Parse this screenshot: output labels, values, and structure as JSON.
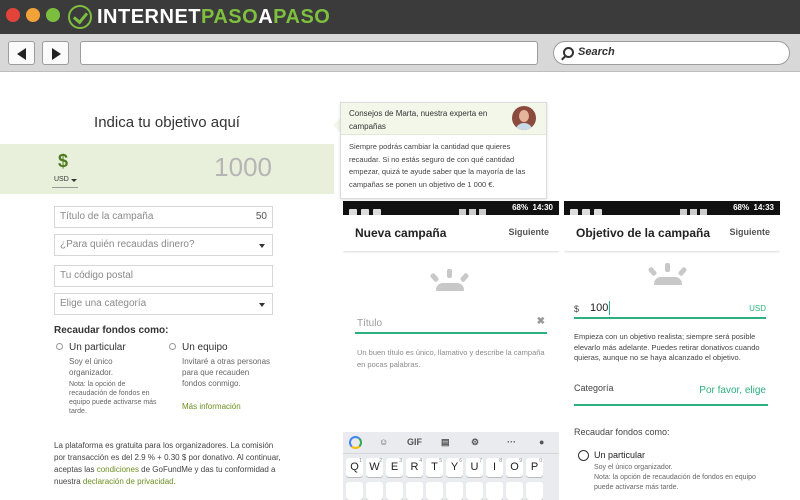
{
  "window": {
    "brand_part1": "INTERNET",
    "brand_part2": "PASO",
    "brand_part3": "A",
    "brand_part4": "PASO",
    "dot_colors": [
      "#e2443a",
      "#f1a33a",
      "#7cbf3f"
    ]
  },
  "toolbar": {
    "back_icon": "arrow-left-icon",
    "forward_icon": "arrow-right-icon",
    "url_value": "",
    "search_placeholder": "Search"
  },
  "web_form": {
    "goal_title": "Indica tu objetivo aquí",
    "currency_symbol": "$",
    "currency_code": "USD",
    "amount_placeholder": "1000",
    "fields": {
      "campaign_title": "Título de la campaña",
      "campaign_title_counter": "50",
      "who_for": "¿Para quién recaudas dinero?",
      "zip_code": "Tu código postal",
      "category": "Elige una categoría"
    },
    "fund_as_label": "Recaudar fondos como:",
    "option_individual": {
      "title": "Un particular",
      "text": "Soy el único organizador.",
      "note": "Nota: la opción de recaudación de fondos en equipo puede activarse más tarde."
    },
    "option_team": {
      "title": "Un equipo",
      "text": "Invitaré a otras personas para que recauden fondos conmigo.",
      "link": "Más información"
    },
    "legal": {
      "part1": "La plataforma es gratuita para los organizadores. La comisión por transacción es del 2.9 % + 0.30 $ por donativo. Al continuar, aceptas las ",
      "link1": "condiciones",
      "part2": " de GoFundMe y das tu conformidad a nuestra ",
      "link2": "declaración de privacidad",
      "part3": "."
    },
    "accent_color": "#6a8f1f"
  },
  "tooltip": {
    "title": "Consejos de Marta, nuestra experta en campañas",
    "body": "Siempre podrás cambiar la cantidad que quieres recaudar. Si no estás seguro de con qué cantidad empezar, quizá te ayude saber que la mayoría de las campañas se ponen un objetivo de 1 000 €."
  },
  "phone1": {
    "battery": "68%",
    "time": "14:30",
    "title": "Nueva campaña",
    "next": "Siguiente",
    "field_placeholder": "Título",
    "help_text": "Un buen título es único, llamativo y describe la campaña en pocas palabras.",
    "keyboard": {
      "tool_gif": "GIF",
      "row1": [
        "Q",
        "W",
        "E",
        "R",
        "T",
        "Y",
        "U",
        "I",
        "O",
        "P"
      ],
      "row1_digits": [
        "1",
        "2",
        "3",
        "4",
        "5",
        "6",
        "7",
        "8",
        "9",
        "0"
      ]
    }
  },
  "phone2": {
    "battery": "68%",
    "time": "14:33",
    "title": "Objetivo de la campaña",
    "next": "Siguiente",
    "currency_symbol": "$",
    "amount": "100",
    "currency_code": "USD",
    "help_text": "Empieza con un objetivo realista; siempre será posible elevarlo más adelante. Puedes retirar donativos cuando quieras, aunque no se haya alcanzado el objetivo.",
    "category_label": "Categoría",
    "category_value": "Por favor, elige",
    "fund_as_label": "Recaudar fondos como:",
    "option_title": "Un particular",
    "option_text": "Soy el único organizador.",
    "option_note": "Nota: la opción de recaudación de fondos en equipo puede activarse más tarde.",
    "accent_color": "#2bb07f"
  }
}
